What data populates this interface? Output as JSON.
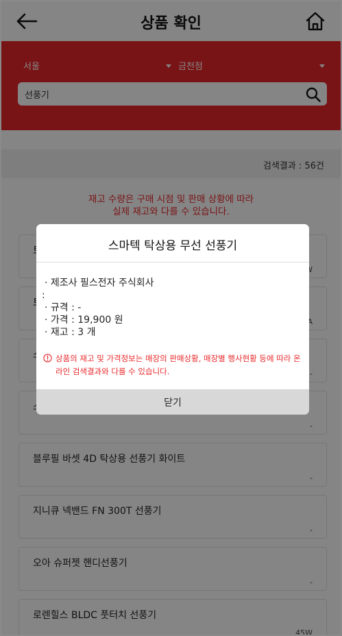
{
  "header": {
    "title": "상품 확인",
    "back_icon": "arrow-left-icon",
    "home_icon": "home-icon"
  },
  "search": {
    "city": "서울",
    "store": "금천점",
    "query": "선풍기",
    "search_icon": "search-icon"
  },
  "results": {
    "count_label": "검색결과 : 56건"
  },
  "notice": {
    "line1": "재고 수량은 구매 시점 및 판매 상황에 따라",
    "line2": "실제 재고와 다를 수 있습니다."
  },
  "products": [
    {
      "name": "",
      "spec": ""
    },
    {
      "name": "",
      "spec": ""
    },
    {
      "name": "",
      "spec": ""
    },
    {
      "name": "",
      "spec": ""
    },
    {
      "name": "블루필 바셋 4D 탁상용 선풍기 화이트",
      "spec": "-"
    },
    {
      "name": "지니큐 넥밴드 FN 300T 선풍기",
      "spec": "-"
    },
    {
      "name": "오아 슈퍼젯 핸디선풍기",
      "spec": "-"
    },
    {
      "name": "로렌힐스 BLDC 풋터치 선풍기",
      "spec": "45W"
    }
  ],
  "peek": {
    "p1_left": "트",
    "p1_right": "W",
    "p2_left": "트",
    "p2_right": "A",
    "p3_left": "스",
    "p3_right": "-",
    "p4_left": "스",
    "p4_right": "-"
  },
  "modal": {
    "title": "스마텍 탁상용 무선 선풍기",
    "maker": "· 제조사 필스전자 주식회사",
    "colon": ":",
    "spec": "· 규격 :  -",
    "price": "· 가격 :  19,900 원",
    "stock": "· 재고 :  3 개",
    "warning": "상품의 재고 및 가격정보는 매장의 판매상황, 매장별 행사현황 등에 따라 온라인 검색결과와 다를 수 있습니다.",
    "close_label": "닫기",
    "warning_icon": "info-circle-icon"
  },
  "colors": {
    "brand_red": "#e8282b",
    "overlay": "rgba(0,0,0,0.48)"
  }
}
